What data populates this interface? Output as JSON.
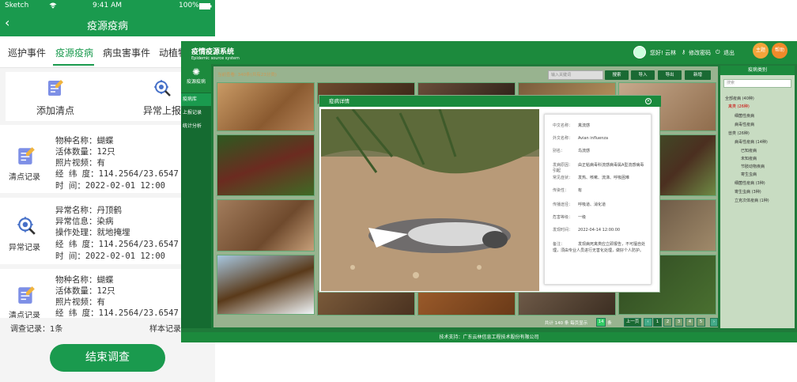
{
  "phone": {
    "status": {
      "carrier": "Sketch",
      "time": "9:41 AM",
      "battery": "100%"
    },
    "nav_title": "疫源疫病",
    "tabs": [
      "巡护事件",
      "疫源疫病",
      "病虫害事件",
      "动植物"
    ],
    "actions": {
      "add_label": "添加清点",
      "report_label": "异常上报"
    },
    "records": [
      {
        "side": "清点记录",
        "lines": [
          "物种名称：蝴蝶",
          "活体数量：12只",
          "照片视频：有",
          "经 纬 度：114.2564/23.6547",
          "时    间：2022-02-01 12:00"
        ]
      },
      {
        "side": "异常记录",
        "lines": [
          "异常名称：丹顶鹤",
          "异常信息：染病",
          "操作处理：就地掩埋",
          "经 纬 度：114.2564/23.6547",
          "时    间：2022-02-01 12:00"
        ]
      },
      {
        "side": "清点记录",
        "lines": [
          "物种名称：蝴蝶",
          "活体数量：12只",
          "照片视频：有",
          "经 纬 度：114.2564/23.6547"
        ]
      }
    ],
    "footer_left": "调查记录：1条",
    "footer_right": "样本记录",
    "end_button": "结束调查"
  },
  "desktop": {
    "title": "疫情疫源系统",
    "subtitle": "Epidemic source system",
    "greeting": "您好! 云林",
    "change_password": "修改密码",
    "logout": "退出",
    "top_buttons": [
      "主题",
      "帮助"
    ],
    "sidebar_header": "疫源疫病",
    "sidebar_items": [
      "疫病库",
      "上报记录",
      "统计分析"
    ],
    "filter_text": "当前查看: 340条(共有23分类)",
    "search_placeholder": "输入关键词",
    "toolbar_buttons": [
      "搜索",
      "导入",
      "导出",
      "新增"
    ],
    "right_header": "疫病类别",
    "right_search": "搜索",
    "tree": [
      "全部疫病 (40种)",
      "禽类 (26种)",
      "细菌性疾病",
      "病毒性疫病",
      "兽类 (26种)",
      "病毒性疫病 (14种)",
      "已知疫病",
      "未知疫病",
      "节肢动物疾病",
      "寄生虫病",
      "细菌性疫病 (3种)",
      "寄生虫病 (3种)",
      "立克次体疫病 (1种)"
    ],
    "pager": {
      "total_text": "共计 140 条 每页显示",
      "page_size": "14",
      "unit": "条",
      "prev": "上一页",
      "pages": [
        "1",
        "2",
        "3",
        "4",
        "5"
      ],
      "next": "下一页"
    },
    "footer": "技术支持：广东云林信息工程技术股份有限公司",
    "modal": {
      "title": "疫病详情",
      "rows": [
        {
          "k": "中文名称：",
          "v": "禽流感"
        },
        {
          "k": "外文名称：",
          "v": "Avian influenza"
        },
        {
          "k": "别名：",
          "v": "鸟流感"
        },
        {
          "k": "发病原因：",
          "v": "由正粘病毒科流感病毒属A型流感病毒引起"
        },
        {
          "k": "常见症状：",
          "v": "发热、咳嗽、流涕、呼吸困难"
        },
        {
          "k": "传染性：",
          "v": "有"
        },
        {
          "k": "传播途径：",
          "v": "呼吸道、消化道"
        },
        {
          "k": "危害等级：",
          "v": "一级"
        },
        {
          "k": "发现时间：",
          "v": "2022-04-14 12:00:00"
        },
        {
          "k": "备注：",
          "v": "发现病死禽类应立即报告，不可擅自处理，须由专业人员进行无害化处理，做好个人防护。"
        }
      ]
    }
  }
}
